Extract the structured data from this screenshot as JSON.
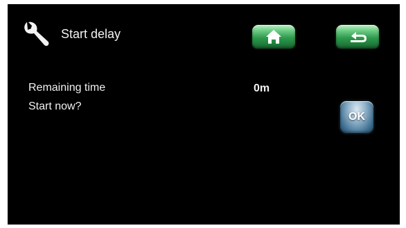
{
  "header": {
    "title": "Start delay",
    "icon": "wrench-icon",
    "home_icon": "home-icon",
    "back_icon": "back-arrow-icon"
  },
  "content": {
    "remaining_label": "Remaining time",
    "remaining_value": "0m",
    "start_label": "Start now?",
    "ok_label": "OK"
  },
  "colors": {
    "background": "#000000",
    "text": "#f2f2f2",
    "nav_button": "#2e9a4d",
    "ok_button": "#3f6f91"
  }
}
